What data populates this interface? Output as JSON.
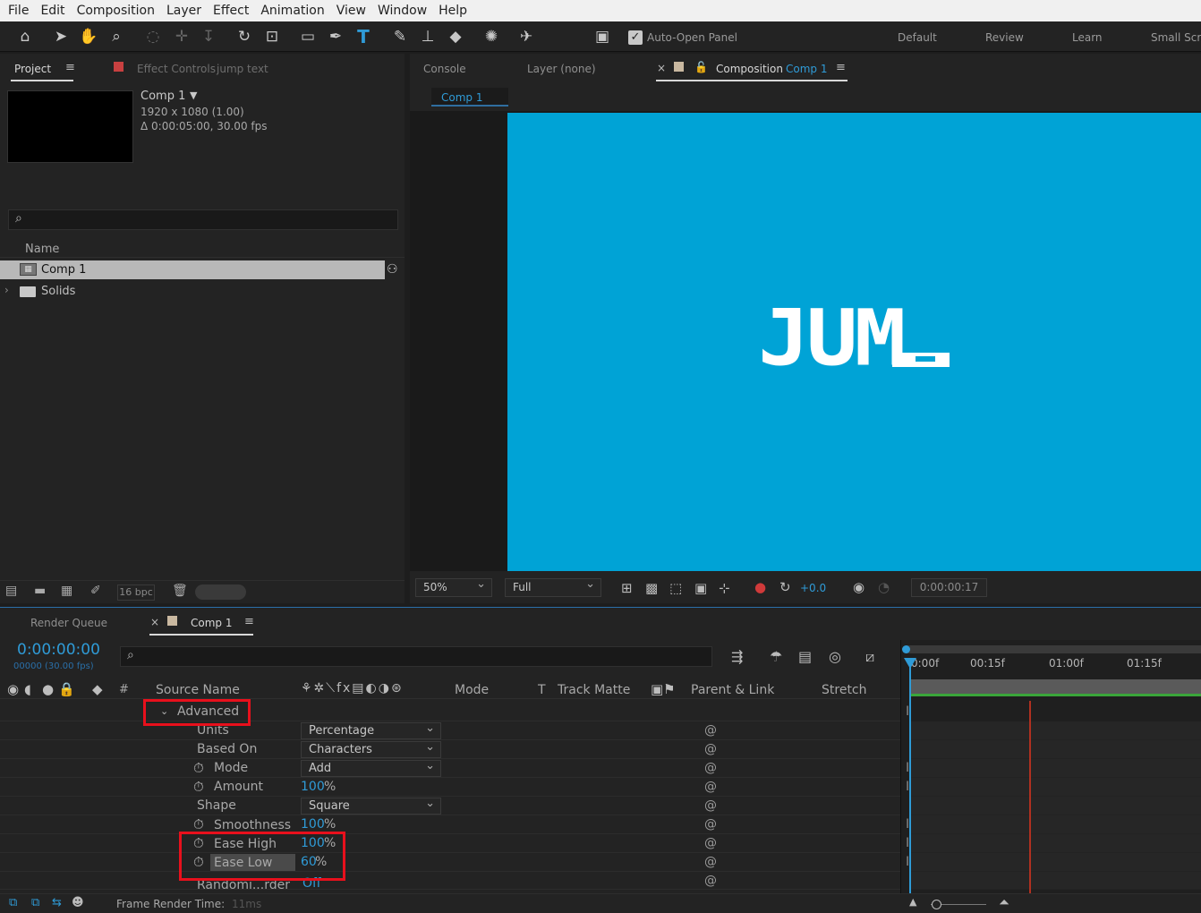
{
  "menu": [
    "File",
    "Edit",
    "Composition",
    "Layer",
    "Effect",
    "Animation",
    "View",
    "Window",
    "Help"
  ],
  "toolbar": {
    "auto_open": "Auto-Open Panel",
    "workspaces": [
      "Default",
      "Review",
      "Learn",
      "Small Scr"
    ]
  },
  "project": {
    "tab": "Project",
    "effect_controls": "Effect Controls",
    "effect_layer": "jump text",
    "comp_name": "Comp 1",
    "comp_res": "1920 x 1080 (1.00)",
    "comp_dur": "Δ 0:00:05:00, 30.00 fps",
    "search_icon": "⌕",
    "col_name": "Name",
    "items": [
      "Comp 1",
      "Solids"
    ],
    "bpc": "16 bpc"
  },
  "viewer": {
    "tab_console": "Console",
    "tab_layer": "Layer (none)",
    "tab_comp": "Composition",
    "tab_comp_name": "Comp 1",
    "breadcrumb": "Comp 1",
    "preview_text": "JUM",
    "bg_color": "#00a3d6",
    "zoom": "50%",
    "resolution": "Full",
    "exposure": "+0.0",
    "timecode": "0:00:00:17"
  },
  "timeline": {
    "tab_render": "Render Queue",
    "tab_comp": "Comp 1",
    "timecode": "0:00:00:00",
    "frames": "00000 (30.00 fps)",
    "col_hash": "#",
    "col_source": "Source Name",
    "col_mode": "Mode",
    "col_t": "T",
    "col_track": "Track Matte",
    "col_parent": "Parent & Link",
    "col_stretch": "Stretch",
    "ruler": [
      "0:00f",
      "00:15f",
      "01:00f",
      "01:15f"
    ],
    "footer": "Frame Render Time:",
    "footer_val": "11ms"
  },
  "properties": [
    {
      "label": "Advanced",
      "value": ""
    },
    {
      "label": "Units",
      "value": "Percentage"
    },
    {
      "label": "Based On",
      "value": "Characters"
    },
    {
      "label": "Mode",
      "value": "Add"
    },
    {
      "label": "Amount",
      "value": "100",
      "unit": "%"
    },
    {
      "label": "Shape",
      "value": "Square"
    },
    {
      "label": "Smoothness",
      "value": "100",
      "unit": "%"
    },
    {
      "label": "Ease High",
      "value": "100",
      "unit": "%"
    },
    {
      "label": "Ease Low",
      "value": "60",
      "unit": "%"
    },
    {
      "label": "Randomi...rder",
      "value": "Off"
    }
  ]
}
